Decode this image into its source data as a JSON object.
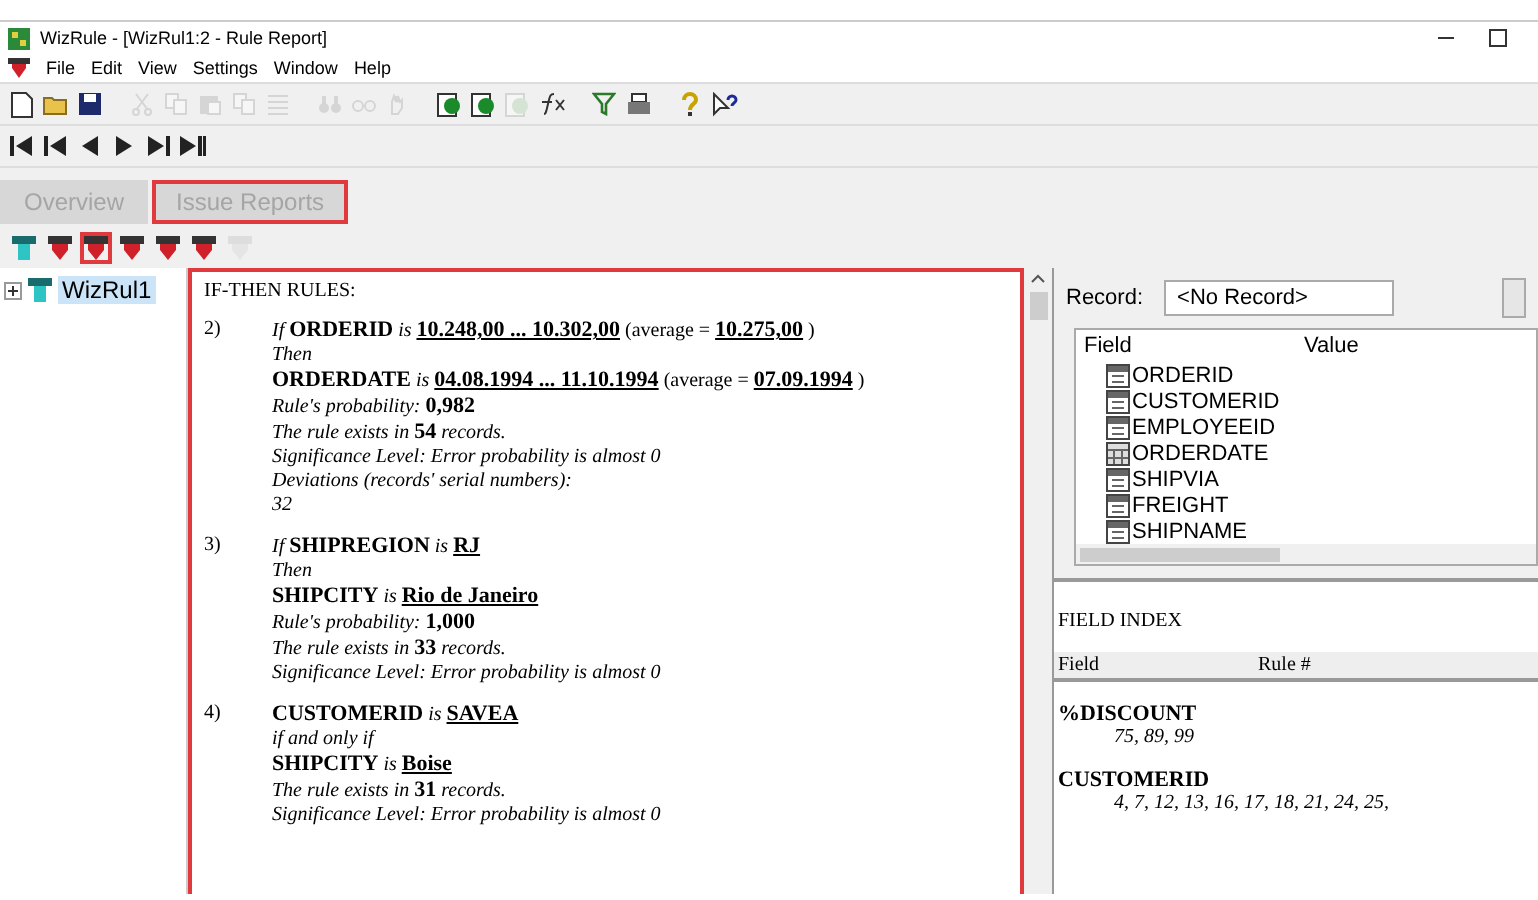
{
  "window": {
    "title": "WizRule - [WizRul1:2 - Rule Report]"
  },
  "menu": [
    "File",
    "Edit",
    "View",
    "Settings",
    "Window",
    "Help"
  ],
  "toolbar": [
    {
      "kind": "new",
      "disabled": false
    },
    {
      "kind": "open",
      "disabled": false
    },
    {
      "kind": "save",
      "disabled": false
    },
    {
      "kind": "sep"
    },
    {
      "kind": "cut",
      "disabled": true
    },
    {
      "kind": "copy",
      "disabled": true
    },
    {
      "kind": "paste",
      "disabled": true
    },
    {
      "kind": "copy",
      "disabled": true
    },
    {
      "kind": "list",
      "disabled": true
    },
    {
      "kind": "sep"
    },
    {
      "kind": "find",
      "disabled": true
    },
    {
      "kind": "glasses",
      "disabled": true
    },
    {
      "kind": "hand",
      "disabled": true
    },
    {
      "kind": "sep"
    },
    {
      "kind": "run",
      "disabled": false
    },
    {
      "kind": "run",
      "disabled": false
    },
    {
      "kind": "run",
      "disabled": true
    },
    {
      "kind": "fx",
      "disabled": false
    },
    {
      "kind": "sep"
    },
    {
      "kind": "filter",
      "disabled": false
    },
    {
      "kind": "print",
      "disabled": false
    },
    {
      "kind": "sep"
    },
    {
      "kind": "help",
      "disabled": false
    },
    {
      "kind": "whatsthis",
      "disabled": false
    }
  ],
  "tabs": [
    {
      "label": "Overview",
      "selected": false
    },
    {
      "label": "Issue Reports",
      "selected": true
    }
  ],
  "report_tools": [
    {
      "kind": "tree",
      "selected": false,
      "disabled": false
    },
    {
      "kind": "report",
      "selected": false,
      "disabled": false
    },
    {
      "kind": "report",
      "selected": true,
      "disabled": false
    },
    {
      "kind": "report",
      "selected": false,
      "disabled": false
    },
    {
      "kind": "report",
      "selected": false,
      "disabled": false
    },
    {
      "kind": "report",
      "selected": false,
      "disabled": false
    },
    {
      "kind": "report",
      "selected": false,
      "disabled": true
    }
  ],
  "tree": [
    {
      "label": "WizRul1",
      "expanded": false,
      "selected": true
    }
  ],
  "report": {
    "heading": "IF-THEN RULES:",
    "rules": [
      {
        "number": "2)",
        "lines": [
          [
            {
              "text": "If ",
              "kind": "note"
            },
            {
              "text": "ORDERID",
              "kind": "field"
            },
            {
              "text": " is ",
              "kind": "note"
            },
            {
              "text": "10.248,00 ... 10.302,00",
              "kind": "value"
            },
            {
              "text": " (average = ",
              "kind": "text"
            },
            {
              "text": "10.275,00",
              "kind": "value"
            },
            {
              "text": " )",
              "kind": "text"
            }
          ],
          [
            {
              "text": "Then",
              "kind": "note"
            }
          ],
          [
            {
              "text": "ORDERDATE",
              "kind": "field"
            },
            {
              "text": " is ",
              "kind": "note"
            },
            {
              "text": "04.08.1994 ... 11.10.1994",
              "kind": "value"
            },
            {
              "text": " (average = ",
              "kind": "text"
            },
            {
              "text": "07.09.1994",
              "kind": "value"
            },
            {
              "text": " )",
              "kind": "text"
            }
          ],
          [
            {
              "text": "Rule's probability: ",
              "kind": "note"
            },
            {
              "text": "0,982",
              "kind": "field"
            }
          ],
          [
            {
              "text": "The rule exists in ",
              "kind": "note"
            },
            {
              "text": "54",
              "kind": "field"
            },
            {
              "text": " records.",
              "kind": "note"
            }
          ],
          [
            {
              "text": "Significance Level:  Error probability is almost 0",
              "kind": "note"
            }
          ],
          [
            {
              "text": "Deviations (records' serial numbers):",
              "kind": "note"
            }
          ],
          [
            {
              "text": "32",
              "kind": "note"
            }
          ]
        ]
      },
      {
        "number": "3)",
        "lines": [
          [
            {
              "text": "If ",
              "kind": "note"
            },
            {
              "text": "SHIPREGION",
              "kind": "field"
            },
            {
              "text": " is ",
              "kind": "note"
            },
            {
              "text": "RJ",
              "kind": "value"
            }
          ],
          [
            {
              "text": "Then",
              "kind": "note"
            }
          ],
          [
            {
              "text": "SHIPCITY",
              "kind": "field"
            },
            {
              "text": " is ",
              "kind": "note"
            },
            {
              "text": "Rio de Janeiro",
              "kind": "value"
            }
          ],
          [
            {
              "text": "Rule's probability: ",
              "kind": "note"
            },
            {
              "text": "1,000",
              "kind": "field"
            }
          ],
          [
            {
              "text": "The rule exists in ",
              "kind": "note"
            },
            {
              "text": "33",
              "kind": "field"
            },
            {
              "text": " records.",
              "kind": "note"
            }
          ],
          [
            {
              "text": "Significance Level:  Error probability is almost 0",
              "kind": "note"
            }
          ]
        ]
      },
      {
        "number": "4)",
        "lines": [
          [
            {
              "text": "CUSTOMERID",
              "kind": "field"
            },
            {
              "text": " is ",
              "kind": "note"
            },
            {
              "text": "SAVEA",
              "kind": "value"
            }
          ],
          [
            {
              "text": " if and only if",
              "kind": "note"
            }
          ],
          [
            {
              "text": "SHIPCITY",
              "kind": "field"
            },
            {
              "text": " is ",
              "kind": "note"
            },
            {
              "text": "Boise",
              "kind": "value"
            }
          ],
          [
            {
              "text": "The rule exists in ",
              "kind": "note"
            },
            {
              "text": "31",
              "kind": "field"
            },
            {
              "text": " records.",
              "kind": "note"
            }
          ],
          [
            {
              "text": "Significance Level:  Error probability is almost 0",
              "kind": "note"
            }
          ]
        ]
      }
    ]
  },
  "record": {
    "label": "Record:",
    "value": "<No Record>"
  },
  "fields": {
    "columns": [
      "Field",
      "Value"
    ],
    "items": [
      {
        "name": "ORDERID",
        "kind": "text"
      },
      {
        "name": "CUSTOMERID",
        "kind": "text"
      },
      {
        "name": "EMPLOYEEID",
        "kind": "text"
      },
      {
        "name": "ORDERDATE",
        "kind": "date"
      },
      {
        "name": "SHIPVIA",
        "kind": "text"
      },
      {
        "name": "FREIGHT",
        "kind": "text"
      },
      {
        "name": "SHIPNAME",
        "kind": "text"
      }
    ]
  },
  "field_index": {
    "title": "FIELD INDEX",
    "columns": [
      "Field",
      "Rule #"
    ],
    "entries": [
      {
        "field": "%DISCOUNT",
        "rules": "75, 89, 99"
      },
      {
        "field": "CUSTOMERID",
        "rules": "4, 7, 12, 13, 16, 17, 18, 21, 24, 25,"
      }
    ]
  }
}
